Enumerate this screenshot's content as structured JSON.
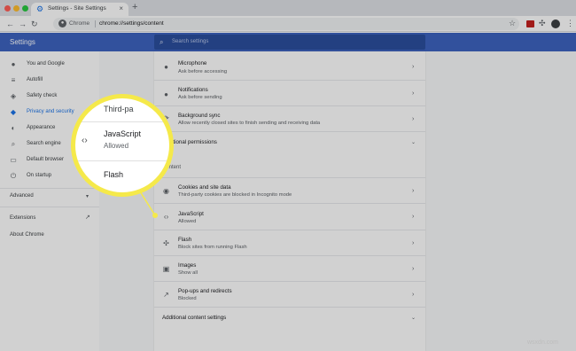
{
  "browser": {
    "tab_title": "Settings - Site Settings",
    "tab_close": "×",
    "new_tab": "+",
    "omnibox_scheme": "Chrome",
    "omnibox_url": "chrome://settings/content"
  },
  "settings_header": {
    "title": "Settings",
    "search_placeholder": "Search settings"
  },
  "sidebar": {
    "items": [
      {
        "label": "You and Google",
        "icon": "person-icon"
      },
      {
        "label": "Autofill",
        "icon": "list-icon"
      },
      {
        "label": "Safety check",
        "icon": "shield-check-icon"
      },
      {
        "label": "Privacy and security",
        "icon": "shield-icon",
        "active": true
      },
      {
        "label": "Appearance",
        "icon": "palette-icon"
      },
      {
        "label": "Search engine",
        "icon": "search-icon"
      },
      {
        "label": "Default browser",
        "icon": "browser-icon"
      },
      {
        "label": "On startup",
        "icon": "power-icon"
      }
    ],
    "advanced": "Advanced",
    "extensions": "Extensions",
    "about": "About Chrome"
  },
  "permissions": {
    "microphone": {
      "title": "Microphone",
      "sub": "Ask before accessing"
    },
    "notifications": {
      "title": "Notifications",
      "sub": "Ask before sending"
    },
    "background_sync": {
      "title": "Background sync",
      "sub": "Allow recently closed sites to finish sending and receiving data"
    },
    "additional": "Additional permissions"
  },
  "content": {
    "heading": "Content",
    "cookies": {
      "title": "Cookies and site data",
      "sub": "Third-party cookies are blocked in Incognito mode"
    },
    "javascript": {
      "title": "JavaScript",
      "sub": "Allowed"
    },
    "flash": {
      "title": "Flash",
      "sub": "Block sites from running Flash"
    },
    "images": {
      "title": "Images",
      "sub": "Show all"
    },
    "popups": {
      "title": "Pop-ups and redirects",
      "sub": "Blocked"
    },
    "additional": "Additional content settings"
  },
  "callout": {
    "top_partial": "Third-pa",
    "title": "JavaScript",
    "sub": "Allowed",
    "bottom": "Flash",
    "border_color": "#f5e94a"
  },
  "watermark": "wsxdn.com",
  "colors": {
    "header_blue": "#3d63c0",
    "accent": "#1a73e8"
  }
}
